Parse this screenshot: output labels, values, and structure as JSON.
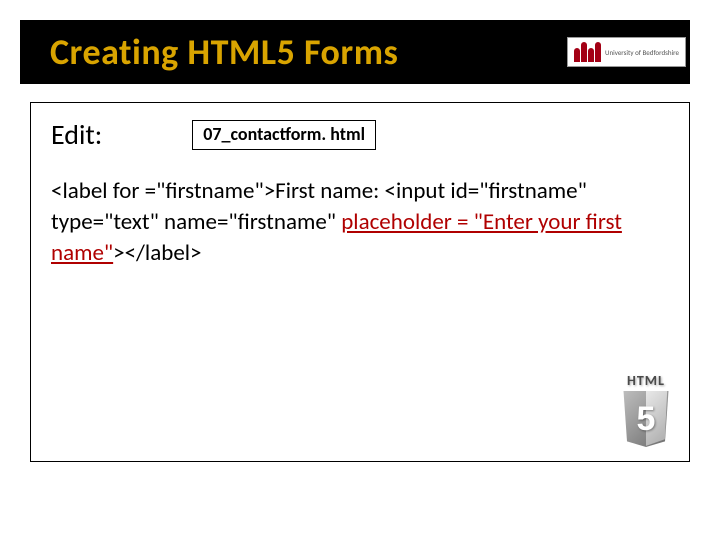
{
  "title": "Creating HTML5 Forms",
  "uni_logo_label": "University of\nBedfordshire",
  "edit_label": "Edit:",
  "file_name": "07_contactform. html",
  "code": {
    "seg1": "<label for =\"firstname\">First name: <input id=\"firstname\" type=\"text\" name=\"firstname\" ",
    "seg2_hl": "placeholder = \"Enter your first name\"",
    "seg3": "></label>"
  },
  "html5_badge": {
    "word": "HTML",
    "number": "5"
  }
}
